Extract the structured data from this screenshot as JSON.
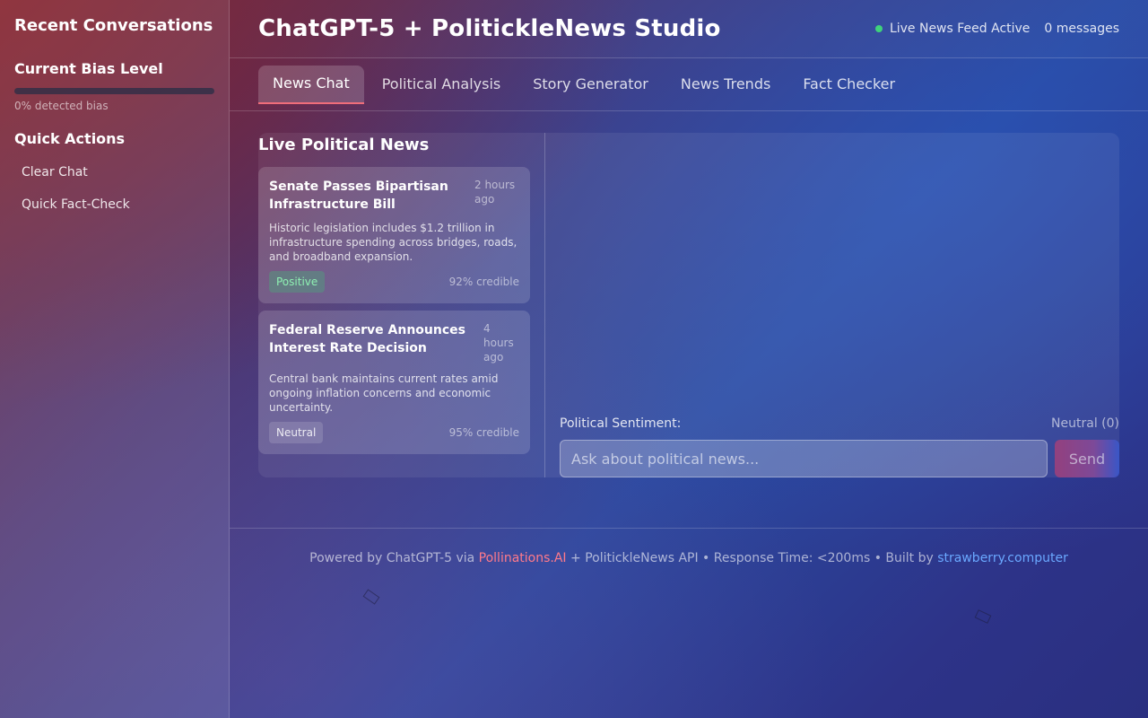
{
  "sidebar": {
    "title": "Recent Conversations",
    "bias": {
      "heading": "Current Bias Level",
      "level": 0,
      "text": "0% detected bias"
    },
    "quick_actions": {
      "heading": "Quick Actions",
      "items": [
        "Clear Chat",
        "Quick Fact-Check"
      ]
    }
  },
  "header": {
    "title": "ChatGPT-5 + PolitickleNews Studio",
    "status": "Live News Feed Active",
    "message_count": "0 messages"
  },
  "tabs": [
    "News Chat",
    "Political Analysis",
    "Story Generator",
    "News Trends",
    "Fact Checker"
  ],
  "active_tab": "News Chat",
  "news": {
    "heading": "Live Political News",
    "items": [
      {
        "title": "Senate Passes Bipartisan Infrastructure Bill",
        "time": "2 hours ago",
        "summary": "Historic legislation includes $1.2 trillion in infrastructure spending across bridges, roads, and broadband expansion.",
        "sentiment": "Positive",
        "credibility": "92% credible"
      },
      {
        "title": "Federal Reserve Announces Interest Rate Decision",
        "time": "4 hours ago",
        "summary": "Central bank maintains current rates amid ongoing inflation concerns and economic uncertainty.",
        "sentiment": "Neutral",
        "credibility": "95% credible"
      }
    ]
  },
  "chat": {
    "sentiment_label": "Political Sentiment:",
    "sentiment_value": "Neutral (0)",
    "input_placeholder": "Ask about political news...",
    "send_label": "Send"
  },
  "footer": {
    "prefix": "Powered by ChatGPT-5 via ",
    "link1": "Pollinations.AI",
    "middle": " + PolitickleNews API • Response Time: <200ms • Built by ",
    "link2": "strawberry.computer"
  },
  "colors": {
    "accent": "#f06d7a",
    "status_green": "#3fd27b",
    "link_blue": "#6aa8ff",
    "link_pink": "#ff7a8a"
  }
}
